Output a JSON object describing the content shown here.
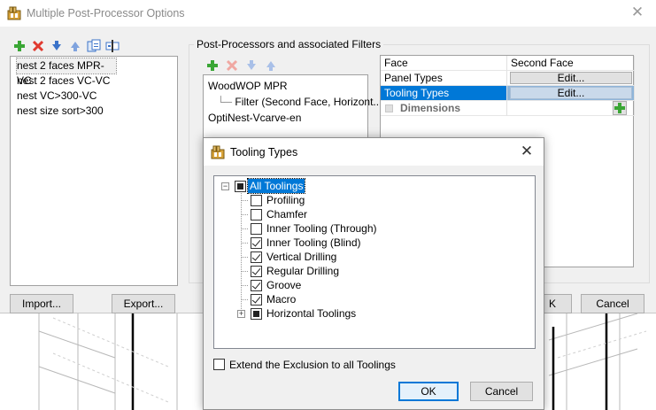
{
  "outer": {
    "title": "Multiple Post-Processor Options",
    "close_glyph": "✕"
  },
  "left_list": {
    "items": [
      "nest 2 faces MPR-VC",
      "nest 2 faces VC-VC",
      "nest VC>300-VC",
      "nest size sort>300"
    ]
  },
  "buttons": {
    "import": "Import...",
    "export": "Export...",
    "ok_partial": "K",
    "cancel": "Cancel"
  },
  "group": {
    "label": "Post-Processors and associated Filters"
  },
  "pp_tree": {
    "root1": "WoodWOP MPR",
    "filter_line": "└─",
    "filter": "Filter (Second Face, Horizont...",
    "root2": "OptiNest-Vcarve-en"
  },
  "grid": {
    "header": [
      "Face",
      "Second Face"
    ],
    "rows": [
      {
        "name": "Panel Types",
        "value": "Edit..."
      },
      {
        "name": "Tooling Types",
        "value": "Edit..."
      }
    ],
    "dimensions": "Dimensions"
  },
  "modal": {
    "title": "Tooling Types",
    "close_glyph": "✕",
    "root": "All Toolings",
    "items": [
      {
        "label": "Profiling",
        "checked": false
      },
      {
        "label": "Chamfer",
        "checked": false
      },
      {
        "label": "Inner Tooling (Through)",
        "checked": false
      },
      {
        "label": "Inner Tooling (Blind)",
        "checked": true
      },
      {
        "label": "Vertical Drilling",
        "checked": true
      },
      {
        "label": "Regular Drilling",
        "checked": true
      },
      {
        "label": "Groove",
        "checked": true
      },
      {
        "label": "Macro",
        "checked": true
      }
    ],
    "horizontal": "Horizontal Toolings",
    "expand_minus": "−",
    "expand_plus": "+",
    "extend_label": "Extend the Exclusion to all Toolings",
    "ok": "OK",
    "cancel": "Cancel"
  },
  "icons": {
    "app": "post-processor-app-icon",
    "add_color": "#3aa635",
    "delete_color": "#e03a2f",
    "arrow_color": "#3b73c9"
  }
}
